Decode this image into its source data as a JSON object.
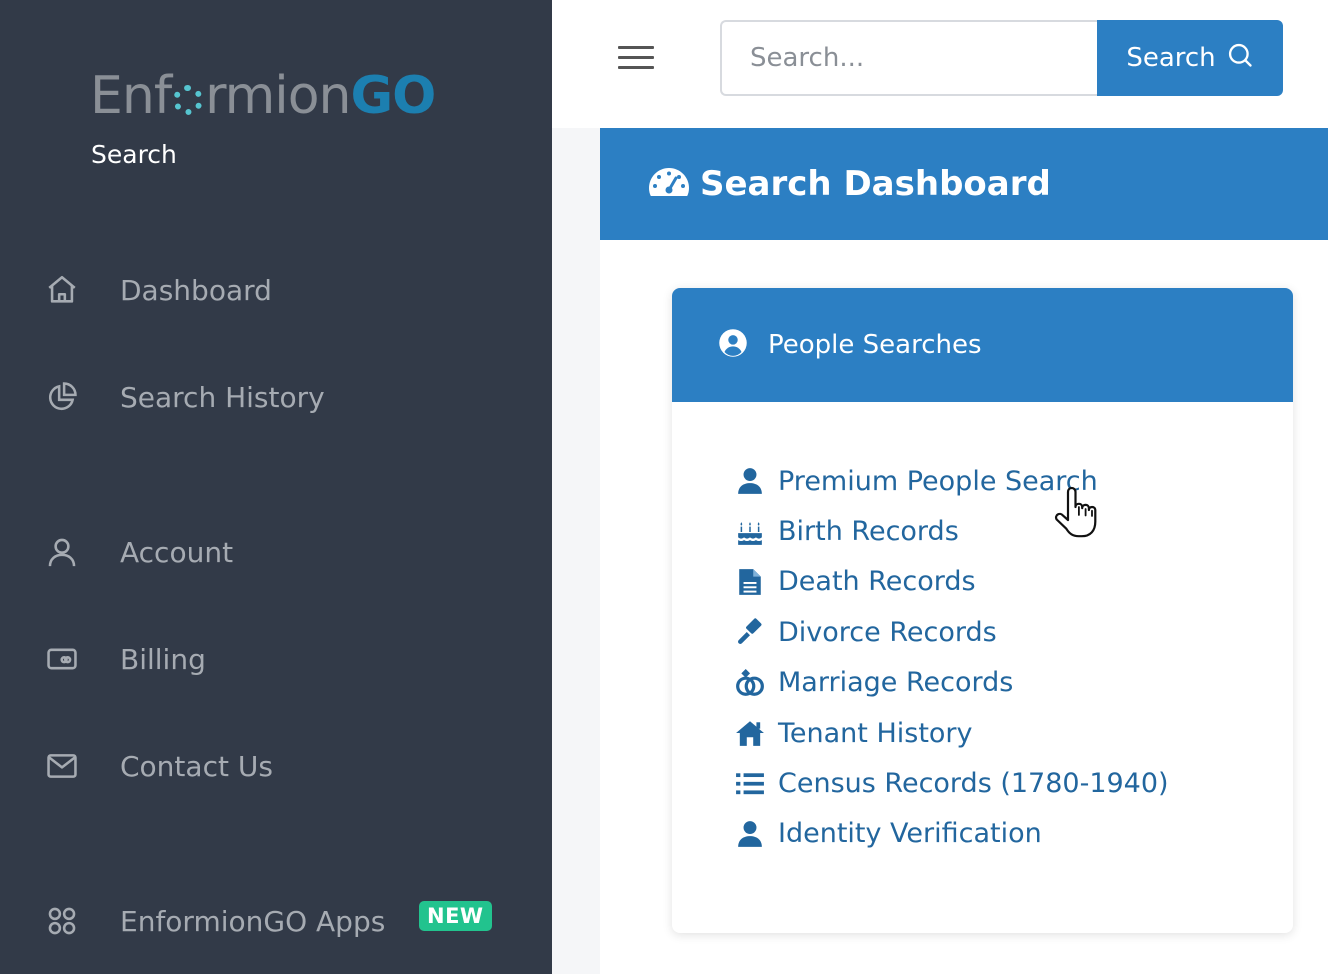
{
  "brand": {
    "logo_part1": "Enf",
    "logo_part2": "rmion",
    "logo_part3": "GO",
    "subtitle": "Search"
  },
  "sidebar": {
    "items": [
      {
        "label": "Dashboard",
        "icon": "home-icon"
      },
      {
        "label": "Search History",
        "icon": "pie-chart-icon"
      },
      {
        "label": "Account",
        "icon": "user-icon"
      },
      {
        "label": "Billing",
        "icon": "billing-icon"
      },
      {
        "label": "Contact Us",
        "icon": "mail-icon"
      },
      {
        "label": "EnformionGO Apps",
        "icon": "apps-icon",
        "badge": "NEW"
      }
    ]
  },
  "header": {
    "search_placeholder": "Search...",
    "search_button": "Search"
  },
  "dashboard": {
    "title": "Search Dashboard"
  },
  "card": {
    "title": "People Searches",
    "links": [
      {
        "label": "Premium People Search",
        "icon": "person-icon"
      },
      {
        "label": "Birth Records",
        "icon": "birthday-cake-icon"
      },
      {
        "label": "Death Records",
        "icon": "document-icon"
      },
      {
        "label": "Divorce Records",
        "icon": "gavel-icon"
      },
      {
        "label": "Marriage Records",
        "icon": "rings-icon"
      },
      {
        "label": "Tenant History",
        "icon": "house-icon"
      },
      {
        "label": "Census Records (1780-1940)",
        "icon": "list-icon"
      },
      {
        "label": "Identity Verification",
        "icon": "person-icon"
      }
    ]
  },
  "colors": {
    "sidebar_bg": "#323a48",
    "primary": "#2c7fc3",
    "link": "#22669e",
    "badge": "#22c38e"
  }
}
